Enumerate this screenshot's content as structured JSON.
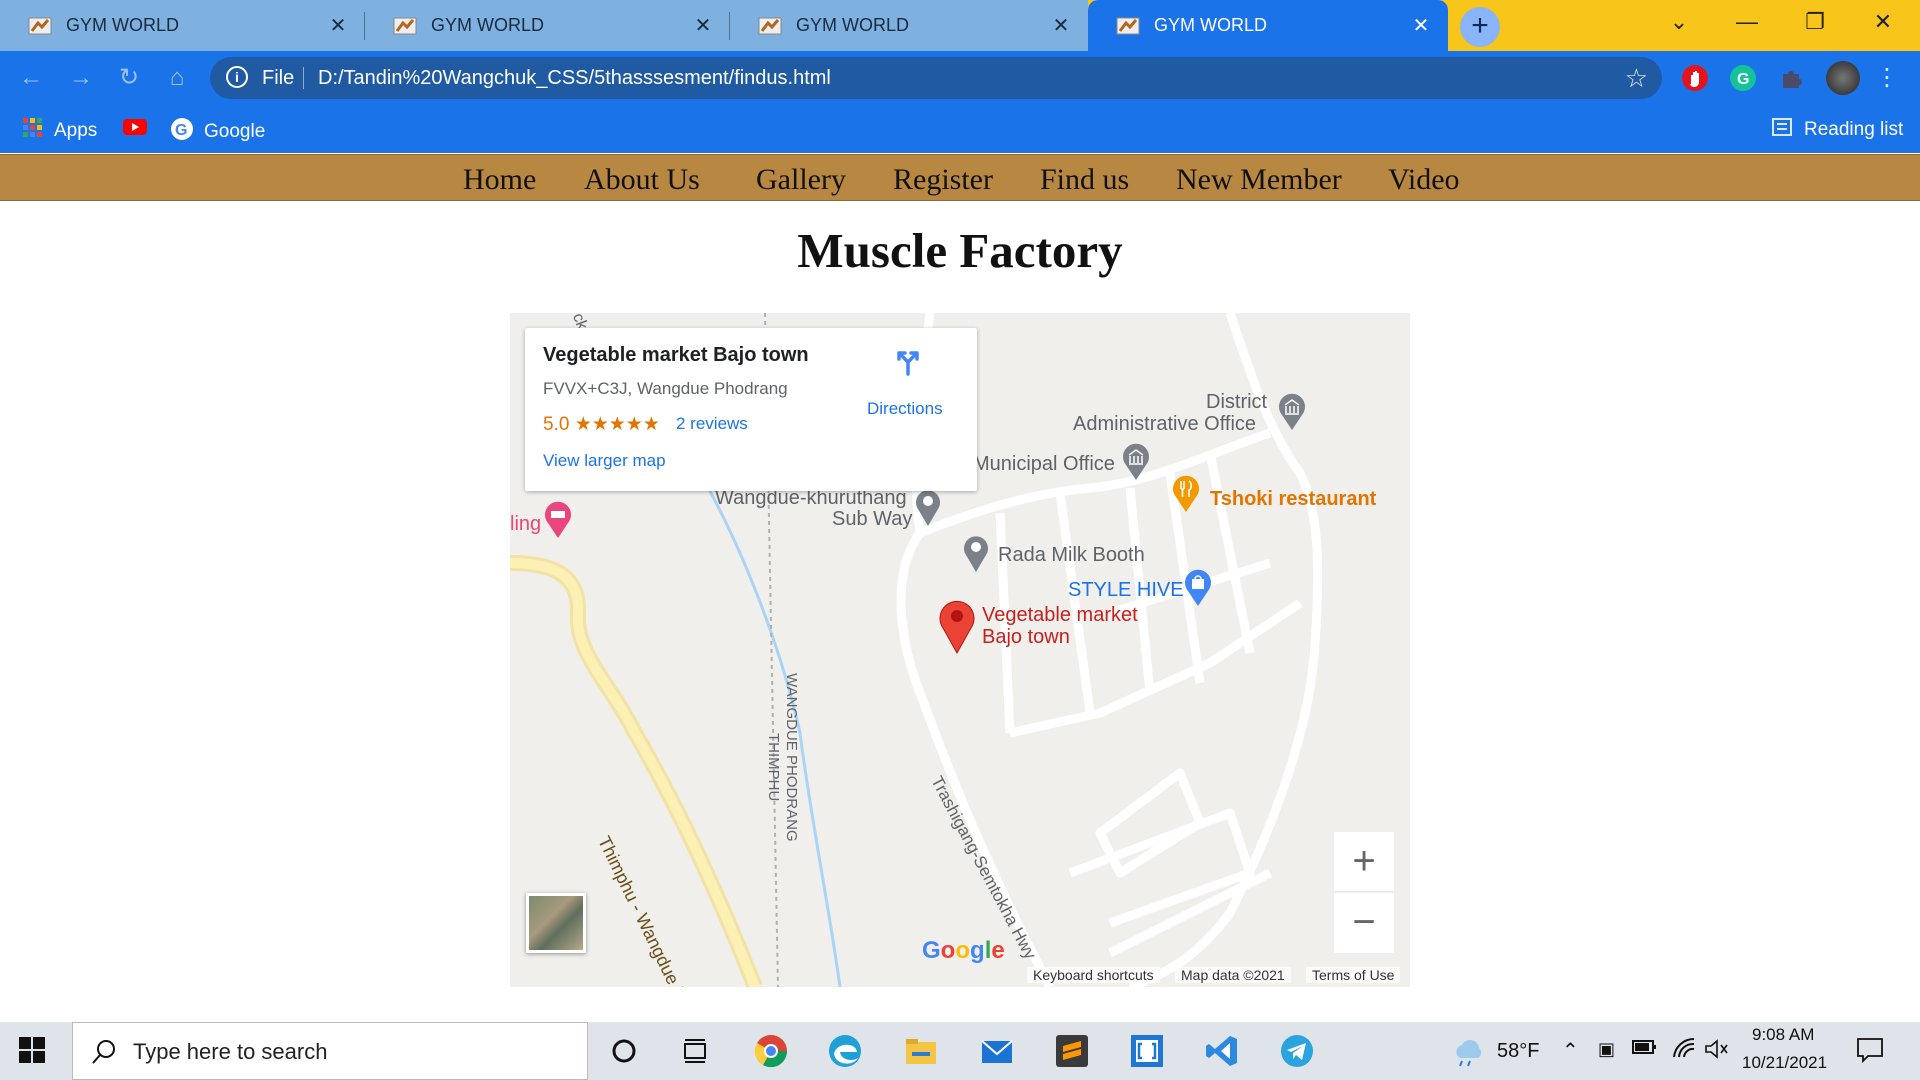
{
  "browser": {
    "tabs": [
      {
        "title": "GYM WORLD",
        "active": false,
        "close": "✕"
      },
      {
        "title": "GYM WORLD",
        "active": false,
        "close": "✕"
      },
      {
        "title": "GYM WORLD",
        "active": false,
        "close": "✕"
      },
      {
        "title": "GYM WORLD",
        "active": true,
        "close": "✕"
      }
    ],
    "new_tab": "+",
    "window_controls": {
      "dropdown": "⌄",
      "minimize": "—",
      "restore": "❐",
      "close": "✕"
    },
    "address": {
      "scheme": "File",
      "url": "D:/Tandin%20Wangchuk_CSS/5thasssesment/findus.html"
    },
    "bookmarks": [
      {
        "label": "Apps",
        "icon": "apps-grid-icon"
      },
      {
        "label": "",
        "icon": "youtube-icon"
      },
      {
        "label": "Google",
        "icon": "google-icon"
      }
    ],
    "reading_list": "Reading list"
  },
  "site": {
    "nav": [
      "Home",
      "About Us",
      "Gallery",
      "Register",
      "Find us",
      "New Member",
      "Video"
    ],
    "title": "Muscle Factory",
    "nav_color": "#b88843"
  },
  "map": {
    "card": {
      "name": "Vegetable market Bajo town",
      "address": "FVVX+C3J, Wangdue Phodrang",
      "rating": "5.0 ★★★★★",
      "reviews": "2 reviews",
      "view_larger": "View larger map",
      "directions": "Directions"
    },
    "labels": {
      "district_1": "District",
      "district_2": "Administrative Office",
      "municipal": "Municipal Office",
      "tshoki": "Tshoki restaurant",
      "khuruthang_1": "Wangdue-khuruthang",
      "khuruthang_2": "Sub Way",
      "lodging": "ling",
      "rada": "Rada Milk Booth",
      "stylehive": "STYLE HIVE",
      "market_1": "Vegetable market",
      "market_2": "Bajo town",
      "hwy_thimphu": "Thimphu - Wangdue Phodrang Hwy",
      "wangdue_phodrang": "WANGDUE PHODRANG",
      "thimphu": "THIMPHU",
      "trashigang": "Trashigang-Semtokha Hwy",
      "top_fragment": "ck"
    },
    "zoom_in": "+",
    "zoom_out": "−",
    "google_logo": "Google",
    "footer": [
      "Keyboard shortcuts",
      "Map data ©2021",
      "Terms of Use"
    ]
  },
  "taskbar": {
    "search_placeholder": "Type here to search",
    "weather": "58°F",
    "time": "9:08 AM",
    "date": "10/21/2021"
  }
}
